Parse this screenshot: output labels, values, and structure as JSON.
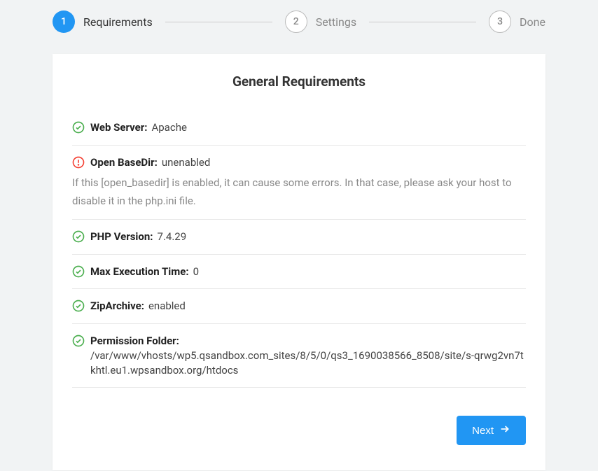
{
  "stepper": {
    "step1": {
      "number": "1",
      "label": "Requirements"
    },
    "step2": {
      "number": "2",
      "label": "Settings"
    },
    "step3": {
      "number": "3",
      "label": "Done"
    }
  },
  "card": {
    "title": "General Requirements"
  },
  "requirements": {
    "webserver": {
      "label": "Web Server",
      "value": "Apache",
      "status": "ok"
    },
    "openbasedir": {
      "label": "Open BaseDir",
      "value": "unenabled",
      "status": "warn",
      "note": "If this [open_basedir] is enabled, it can cause some errors. In that case, please ask your host to disable it in the php.ini file."
    },
    "phpversion": {
      "label": "PHP Version",
      "value": "7.4.29",
      "status": "ok"
    },
    "maxexec": {
      "label": "Max Execution Time",
      "value": "0",
      "status": "ok"
    },
    "ziparchive": {
      "label": "ZipArchive",
      "value": "enabled",
      "status": "ok"
    },
    "permfolder": {
      "label": "Permission Folder",
      "value": "/var/www/vhosts/wp5.qsandbox.com_sites/8/5/0/qs3_1690038566_8508/site/s-qrwg2vn7tkhtl.eu1.wpsandbox.org/htdocs",
      "status": "ok"
    }
  },
  "actions": {
    "next": "Next"
  }
}
